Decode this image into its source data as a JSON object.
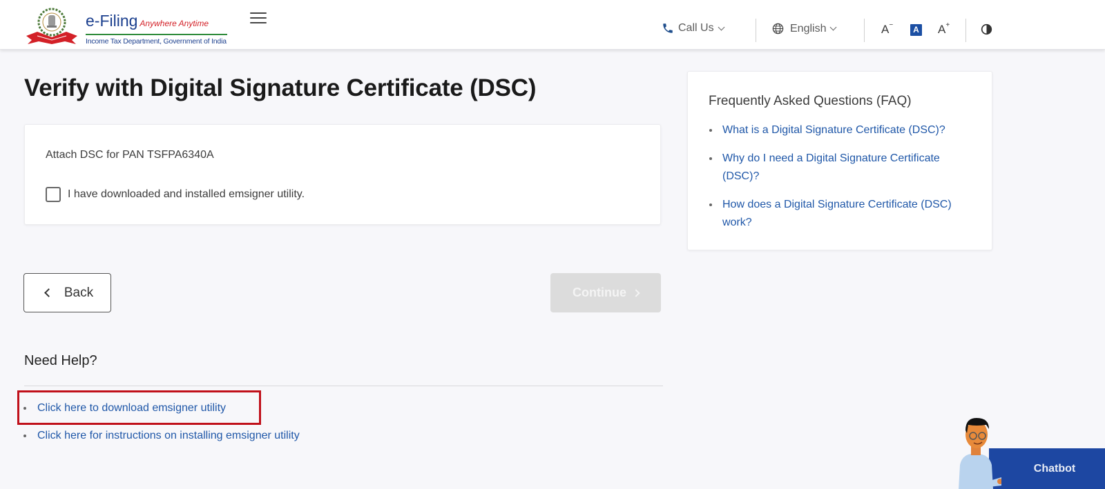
{
  "header": {
    "brand_title": "e-Filing",
    "brand_tagline": "Anywhere Anytime",
    "brand_subtitle": "Income Tax Department, Government of India",
    "call_us_label": "Call Us",
    "language_label": "English",
    "font_decrease_label": "A",
    "font_default_label": "A",
    "font_increase_label": "A",
    "icons": {
      "menu": "hamburger-icon",
      "phone": "phone-icon",
      "globe": "globe-icon",
      "contrast": "contrast-icon"
    },
    "colors": {
      "brand_blue": "#1b3f8e",
      "tagline_red": "#d32027",
      "active_font_bg": "#1b4fa3"
    }
  },
  "main": {
    "title": "Verify with Digital Signature Certificate (DSC)",
    "attach_label": "Attach DSC for PAN TSFPA6340A",
    "checkbox_label": "I have downloaded and installed emsigner utility.",
    "checkbox_checked": false,
    "back_label": "Back",
    "continue_label": "Continue",
    "continue_disabled": true
  },
  "help": {
    "title": "Need Help?",
    "links": [
      {
        "label": "Click here to download emsigner utility",
        "highlighted": true
      },
      {
        "label": "Click here for instructions on installing emsigner utility",
        "highlighted": false
      }
    ],
    "highlight_color": "#c0101a"
  },
  "faq": {
    "title": "Frequently Asked Questions (FAQ)",
    "items": [
      {
        "label": "What is a Digital Signature Certificate (DSC)?"
      },
      {
        "label": "Why do I need a Digital Signature Certificate (DSC)?"
      },
      {
        "label": "How does a Digital Signature Certificate (DSC) work?"
      }
    ],
    "link_color": "#1f57a8"
  },
  "chatbot": {
    "label": "Chatbot",
    "color": "#1d47a2"
  }
}
